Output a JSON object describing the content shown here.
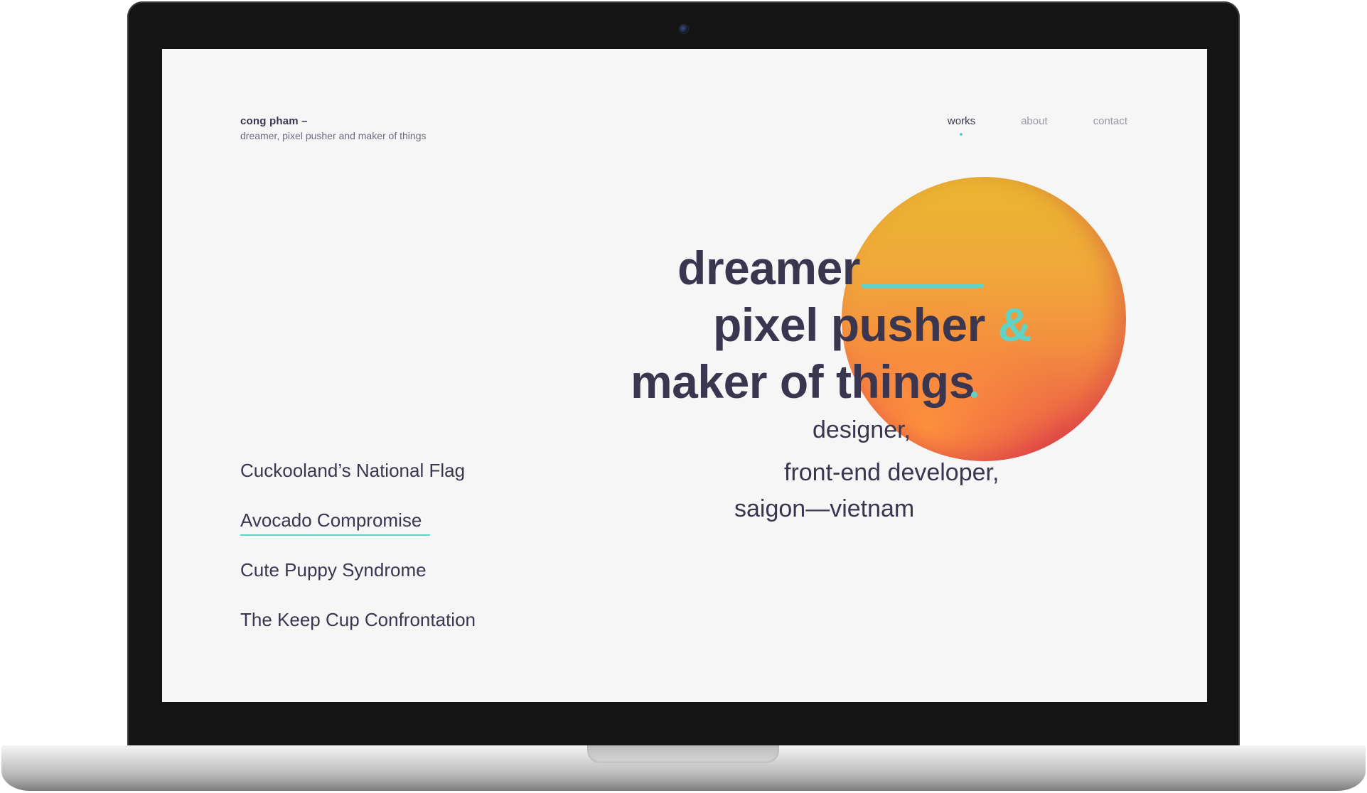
{
  "brand": {
    "name": "cong pham –",
    "tagline": "dreamer, pixel pusher and maker of things"
  },
  "nav": {
    "items": [
      {
        "label": "works",
        "active": true
      },
      {
        "label": "about",
        "active": false
      },
      {
        "label": "contact",
        "active": false
      }
    ]
  },
  "hero": {
    "line1": "dreamer",
    "line2_text": "pixel pusher",
    "line2_accent": "&",
    "line3": "maker of things"
  },
  "subtitle": {
    "line1": "designer,",
    "line2": "front-end developer,",
    "line3": "saigon—vietnam"
  },
  "works": {
    "items": [
      {
        "label": "Cuckooland’s National Flag",
        "active": false
      },
      {
        "label": "Avocado Compromise",
        "active": true
      },
      {
        "label": "Cute Puppy Syndrome",
        "active": false
      },
      {
        "label": "The Keep Cup Confrontation",
        "active": false
      }
    ]
  },
  "colors": {
    "accent": "#5fd3c6",
    "text_dark": "#3a3650",
    "text_muted": "#9a98a6",
    "background": "#f6f6f6",
    "sun_top": "#e9b730",
    "sun_bottom": "#e2484b"
  }
}
